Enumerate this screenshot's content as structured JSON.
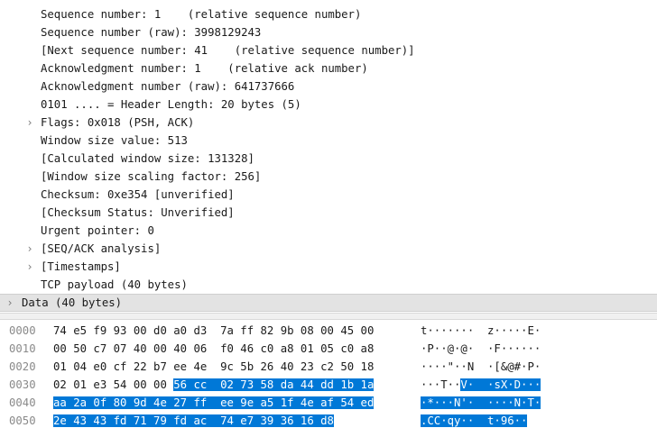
{
  "details": {
    "rows": [
      {
        "text": "Sequence number: 1    (relative sequence number)",
        "expandable": false
      },
      {
        "text": "Sequence number (raw): 3998129243",
        "expandable": false
      },
      {
        "text": "[Next sequence number: 41    (relative sequence number)]",
        "expandable": false
      },
      {
        "text": "Acknowledgment number: 1    (relative ack number)",
        "expandable": false
      },
      {
        "text": "Acknowledgment number (raw): 641737666",
        "expandable": false
      },
      {
        "text": "0101 .... = Header Length: 20 bytes (5)",
        "expandable": false
      },
      {
        "text": "Flags: 0x018 (PSH, ACK)",
        "expandable": true
      },
      {
        "text": "Window size value: 513",
        "expandable": false
      },
      {
        "text": "[Calculated window size: 131328]",
        "expandable": false
      },
      {
        "text": "[Window size scaling factor: 256]",
        "expandable": false
      },
      {
        "text": "Checksum: 0xe354 [unverified]",
        "expandable": false
      },
      {
        "text": "[Checksum Status: Unverified]",
        "expandable": false
      },
      {
        "text": "Urgent pointer: 0",
        "expandable": false
      },
      {
        "text": "[SEQ/ACK analysis]",
        "expandable": true
      },
      {
        "text": "[Timestamps]",
        "expandable": true
      },
      {
        "text": "TCP payload (40 bytes)",
        "expandable": false
      }
    ],
    "selected": {
      "text": "Data (40 bytes)",
      "expandable": true
    }
  },
  "hex": {
    "rows": [
      {
        "offset": "0000",
        "pre": "74 e5 f9 93 00 d0 a0 d3  7a ff 82 9b 08 00 45 00",
        "sel": "",
        "ascii_pre": "t·······  z·····E·",
        "ascii_sel": ""
      },
      {
        "offset": "0010",
        "pre": "00 50 c7 07 40 00 40 06  f0 46 c0 a8 01 05 c0 a8",
        "sel": "",
        "ascii_pre": "·P··@·@·  ·F······",
        "ascii_sel": ""
      },
      {
        "offset": "0020",
        "pre": "01 04 e0 cf 22 b7 ee 4e  9c 5b 26 40 23 c2 50 18",
        "sel": "",
        "ascii_pre": "····\"··N  ·[&@#·P·",
        "ascii_sel": ""
      },
      {
        "offset": "0030",
        "pre": "02 01 e3 54 00 00 ",
        "sel": "56 cc  02 73 58 da 44 dd 1b 1a",
        "ascii_pre": "···T··",
        "ascii_sel": "V·  ·sX·D···"
      },
      {
        "offset": "0040",
        "pre": "",
        "sel": "aa 2a 0f 80 9d 4e 27 ff  ee 9e a5 1f 4e af 54 ed",
        "ascii_pre": "",
        "ascii_sel": "·*···N'·  ····N·T·"
      },
      {
        "offset": "0050",
        "pre": "",
        "sel": "2e 43 43 fd 71 79 fd ac  74 e7 39 36 16 d8",
        "ascii_pre": "",
        "ascii_sel": ".CC·qy··  t·96··"
      }
    ]
  },
  "icons": {
    "collapsed": "›"
  },
  "colors": {
    "selection": "#0078d7",
    "selected_row": "#e3e3e3",
    "offset": "#8a8a8a"
  }
}
